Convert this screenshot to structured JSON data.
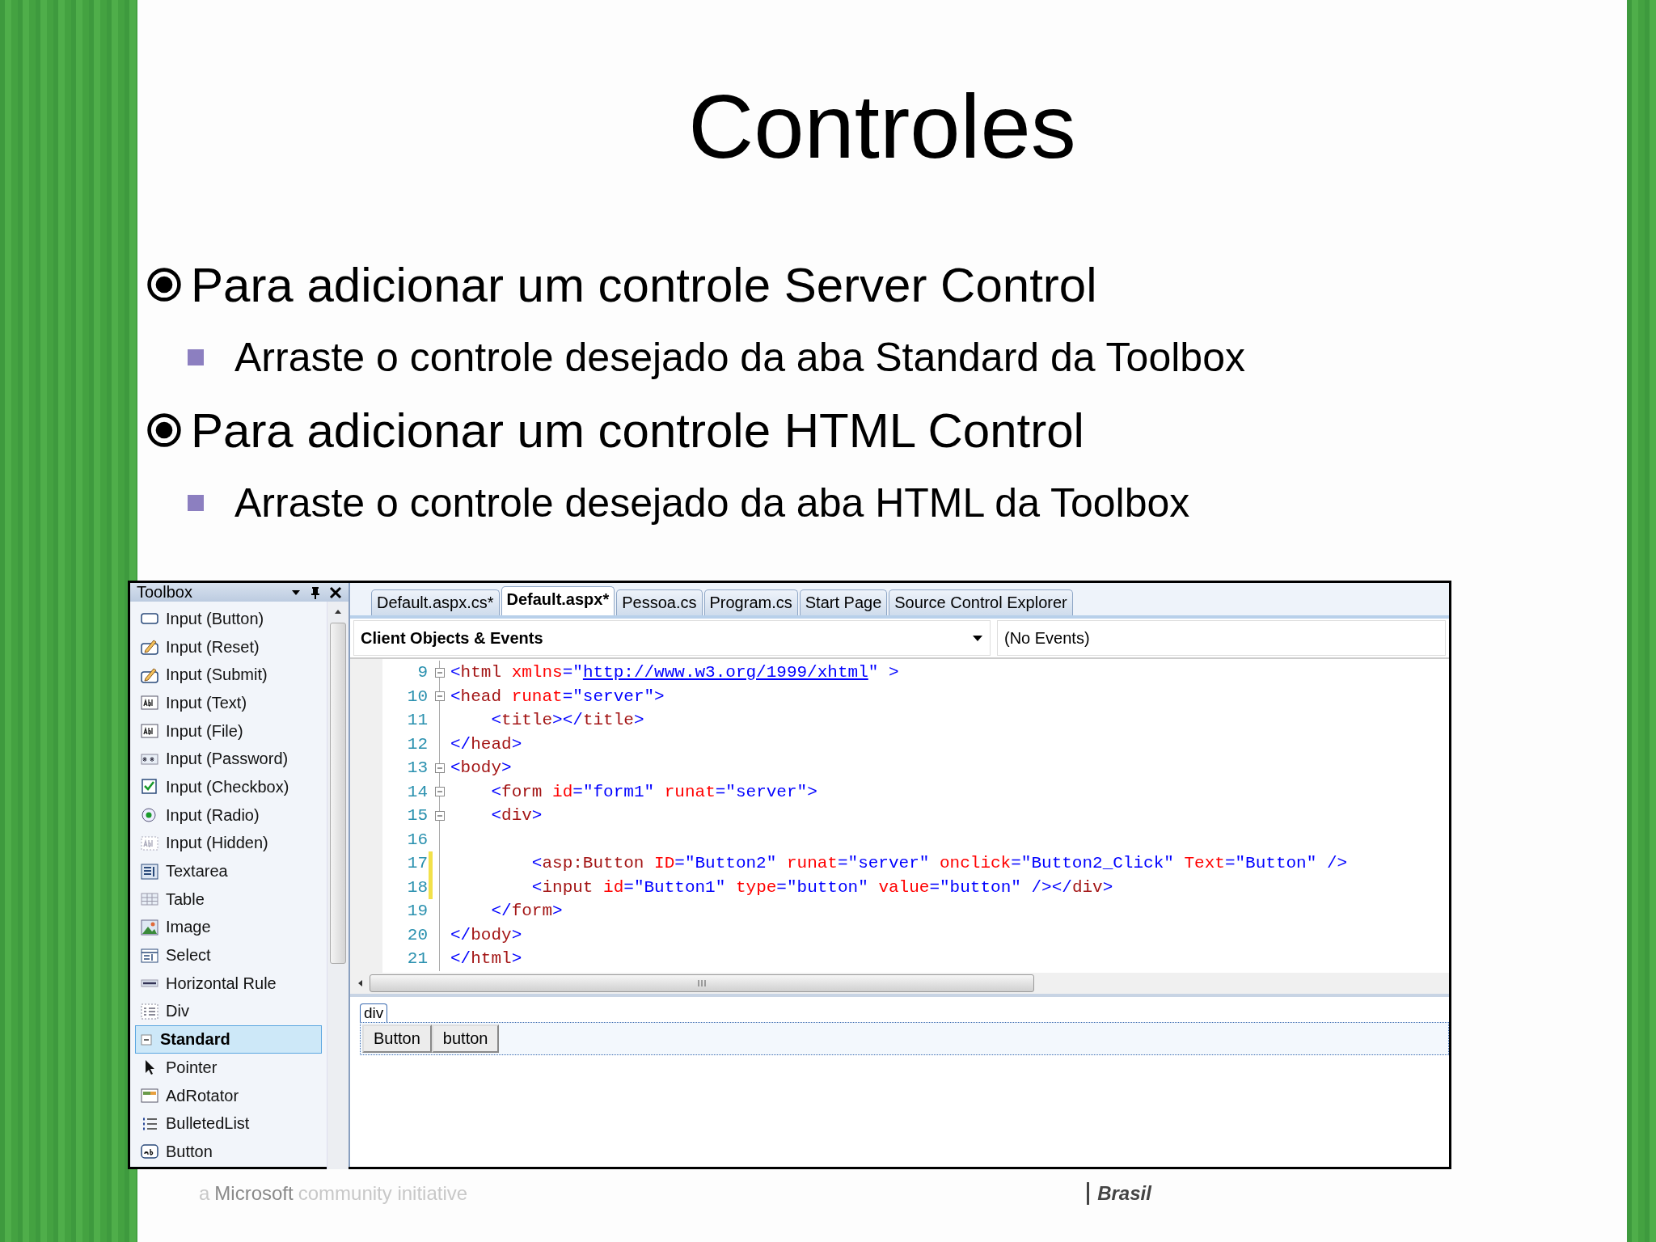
{
  "slide": {
    "title": "Controles",
    "bullets": [
      {
        "text": "Para adicionar um controle Server Control",
        "sub": "Arraste o controle desejado da aba Standard da Toolbox"
      },
      {
        "text": "Para adicionar um controle HTML Control",
        "sub": "Arraste o controle desejado da aba HTML da Toolbox"
      }
    ]
  },
  "toolbox": {
    "title": "Toolbox",
    "items": [
      {
        "kind": "item",
        "label": "Input (Button)",
        "selected": false
      },
      {
        "kind": "item",
        "label": "Input (Reset)",
        "selected": false
      },
      {
        "kind": "item",
        "label": "Input (Submit)",
        "selected": false
      },
      {
        "kind": "item",
        "label": "Input (Text)",
        "selected": false
      },
      {
        "kind": "item",
        "label": "Input (File)",
        "selected": false
      },
      {
        "kind": "item",
        "label": "Input (Password)",
        "selected": false
      },
      {
        "kind": "item",
        "label": "Input (Checkbox)",
        "selected": false
      },
      {
        "kind": "item",
        "label": "Input (Radio)",
        "selected": false
      },
      {
        "kind": "item",
        "label": "Input (Hidden)",
        "selected": false
      },
      {
        "kind": "item",
        "label": "Textarea",
        "selected": false
      },
      {
        "kind": "item",
        "label": "Table",
        "selected": false
      },
      {
        "kind": "item",
        "label": "Image",
        "selected": false
      },
      {
        "kind": "item",
        "label": "Select",
        "selected": false
      },
      {
        "kind": "item",
        "label": "Horizontal Rule",
        "selected": false
      },
      {
        "kind": "item",
        "label": "Div",
        "selected": false
      },
      {
        "kind": "group",
        "label": "Standard",
        "expanded": true,
        "selected": true
      },
      {
        "kind": "item",
        "label": "Pointer",
        "selected": false
      },
      {
        "kind": "item",
        "label": "AdRotator",
        "selected": false
      },
      {
        "kind": "item",
        "label": "BulletedList",
        "selected": false
      },
      {
        "kind": "item",
        "label": "Button",
        "selected": false
      }
    ]
  },
  "editor": {
    "tabs": [
      {
        "label": "Default.aspx.cs*",
        "selected": false
      },
      {
        "label": "Default.aspx*",
        "selected": true
      },
      {
        "label": "Pessoa.cs",
        "selected": false
      },
      {
        "label": "Program.cs",
        "selected": false
      },
      {
        "label": "Start Page",
        "selected": false
      },
      {
        "label": "Source Control Explorer",
        "selected": false
      }
    ],
    "object_dropdown": "Client Objects & Events",
    "event_dropdown": "(No Events)",
    "code_lines": [
      {
        "number": "9",
        "collapsible": true,
        "changed": false,
        "text": "<html xmlns=\"http://www.w3.org/1999/xhtml\" >"
      },
      {
        "number": "10",
        "collapsible": true,
        "changed": false,
        "text": "<head runat=\"server\">"
      },
      {
        "number": "11",
        "collapsible": false,
        "changed": false,
        "text": "    <title></title>"
      },
      {
        "number": "12",
        "collapsible": false,
        "changed": false,
        "text": "</head>"
      },
      {
        "number": "13",
        "collapsible": true,
        "changed": false,
        "text": "<body>"
      },
      {
        "number": "14",
        "collapsible": true,
        "changed": false,
        "text": "    <form id=\"form1\" runat=\"server\">"
      },
      {
        "number": "15",
        "collapsible": true,
        "changed": false,
        "text": "    <div>"
      },
      {
        "number": "16",
        "collapsible": false,
        "changed": false
      },
      {
        "number": "17",
        "collapsible": false,
        "changed": true,
        "text": "        <asp:Button ID=\"Button2\" runat=\"server\" onclick=\"Button2_Click\" Text=\"Button\" />"
      },
      {
        "number": "18",
        "collapsible": false,
        "changed": true,
        "text": "        <input id=\"Button1\" type=\"button\" value=\"button\" /></div>"
      },
      {
        "number": "19",
        "collapsible": false,
        "changed": false,
        "text": "    </form>"
      },
      {
        "number": "20",
        "collapsible": false,
        "changed": false,
        "text": "</body>"
      },
      {
        "number": "21",
        "collapsible": false,
        "changed": false,
        "text": "</html>"
      }
    ],
    "design": {
      "tag": "div",
      "buttons": [
        "Button",
        "button"
      ]
    }
  },
  "footer": {
    "prefix": "a",
    "brand": "Microsoft",
    "suffix": "community initiative",
    "logo": "Brasil"
  }
}
